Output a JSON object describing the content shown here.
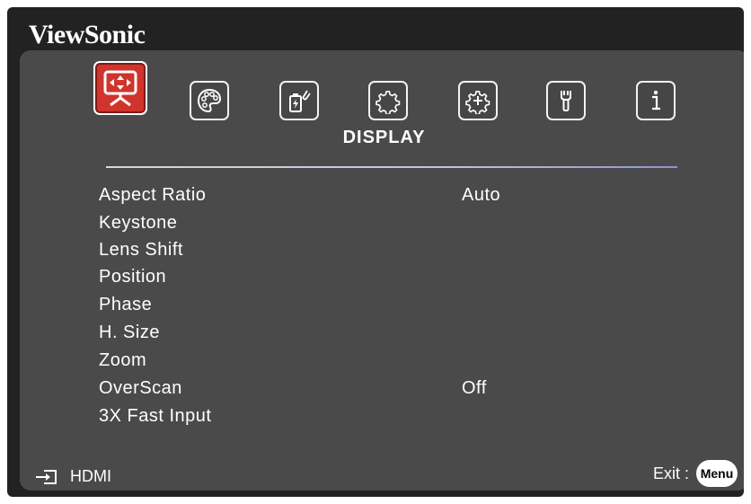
{
  "brand": "ViewSonic",
  "tabs": [
    {
      "name": "display",
      "active": true
    },
    {
      "name": "image-settings",
      "active": false
    },
    {
      "name": "power-management",
      "active": false
    },
    {
      "name": "basic",
      "active": false
    },
    {
      "name": "advanced",
      "active": false
    },
    {
      "name": "maintenance",
      "active": false
    },
    {
      "name": "information",
      "active": false
    }
  ],
  "active_tab_title": "DISPLAY",
  "menu": {
    "items": [
      {
        "label": "Aspect Ratio",
        "value": "Auto"
      },
      {
        "label": "Keystone",
        "value": ""
      },
      {
        "label": "Lens Shift",
        "value": ""
      },
      {
        "label": "Position",
        "value": ""
      },
      {
        "label": "Phase",
        "value": ""
      },
      {
        "label": "H. Size",
        "value": ""
      },
      {
        "label": "Zoom",
        "value": ""
      },
      {
        "label": "OverScan",
        "value": "Off"
      },
      {
        "label": "3X Fast Input",
        "value": ""
      }
    ]
  },
  "footer": {
    "source": "HDMI",
    "exit_label": "Exit :",
    "menu_button": "Menu"
  },
  "colors": {
    "background": "#222222",
    "panel": "#4a4a4a",
    "active_tab": "#d0342c",
    "text": "#ffffff"
  }
}
